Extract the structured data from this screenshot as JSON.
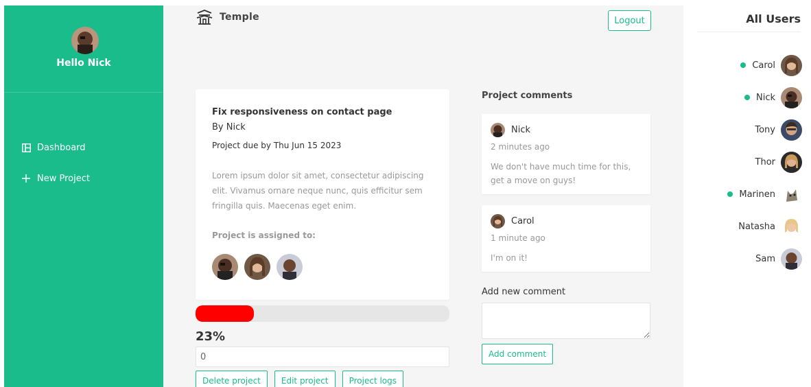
{
  "sidebar": {
    "greeting": "Hello Nick",
    "nav": [
      {
        "label": "Dashboard",
        "icon": "dashboard-icon"
      },
      {
        "label": "New Project",
        "icon": "plus-icon"
      }
    ]
  },
  "header": {
    "app_name": "Temple",
    "logo_icon": "temple-icon",
    "logout_label": "Logout"
  },
  "project": {
    "title": "Fix responsiveness on contact page",
    "author": "By Nick",
    "due": "Project due by Thu Jun 15 2023",
    "description": "Lorem ipsum dolor sit amet, consectetur adipiscing elit. Vivamus ornare neque nunc, quis efficitur sem fringilla quis. Maecenas eget enim.",
    "assigned_label": "Project is assigned to:",
    "assignees": [
      "Nick",
      "Carol",
      "Sam"
    ],
    "progress": 23,
    "progress_text": "23%",
    "progress_input_value": "0",
    "actions": {
      "delete": "Delete project",
      "edit": "Edit project",
      "logs": "Project logs"
    }
  },
  "comments": {
    "heading": "Project comments",
    "items": [
      {
        "author": "Nick",
        "time": "2 minutes ago",
        "text": "We don't have much time for this, get a move on guys!"
      },
      {
        "author": "Carol",
        "time": "1 minute ago",
        "text": "I'm on it!"
      }
    ],
    "add_label": "Add new comment",
    "add_button": "Add comment"
  },
  "users": {
    "title": "All Users",
    "list": [
      {
        "name": "Carol",
        "online": true
      },
      {
        "name": "Nick",
        "online": true
      },
      {
        "name": "Tony",
        "online": false
      },
      {
        "name": "Thor",
        "online": false
      },
      {
        "name": "Marinen",
        "online": true
      },
      {
        "name": "Natasha",
        "online": false
      },
      {
        "name": "Sam",
        "online": false
      }
    ]
  },
  "colors": {
    "accent": "#1abc8c",
    "progress": "#ff0000",
    "online": "#1abc8c"
  }
}
